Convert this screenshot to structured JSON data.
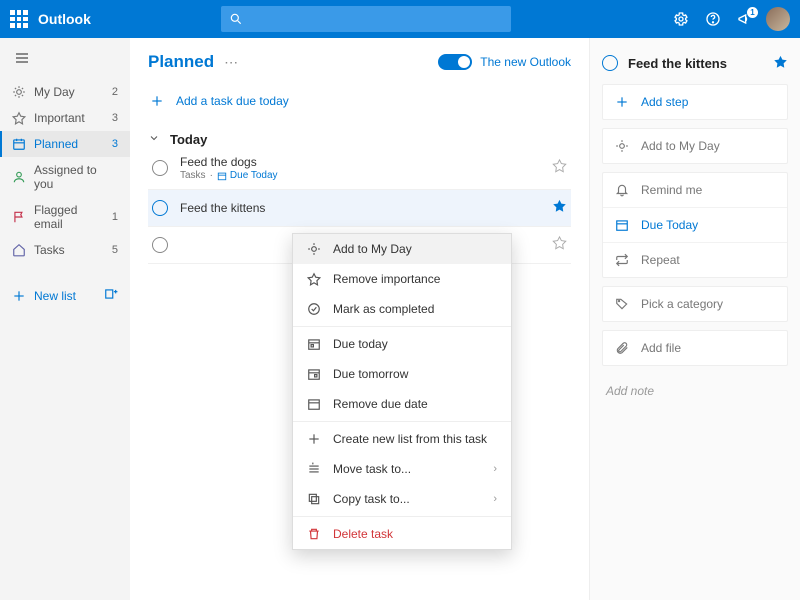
{
  "header": {
    "brand": "Outlook",
    "notification_count": "1"
  },
  "sidebar": {
    "items": [
      {
        "label": "My Day",
        "count": "2"
      },
      {
        "label": "Important",
        "count": "3"
      },
      {
        "label": "Planned",
        "count": "3"
      },
      {
        "label": "Assigned to you",
        "count": ""
      },
      {
        "label": "Flagged email",
        "count": "1"
      },
      {
        "label": "Tasks",
        "count": "5"
      }
    ],
    "new_list": "New list"
  },
  "main": {
    "title": "Planned",
    "toggle_label": "The new Outlook",
    "add_task": "Add a task due today",
    "section": "Today",
    "tasks": [
      {
        "title": "Feed the dogs",
        "sub_list": "Tasks",
        "due": "Due Today",
        "starred": false
      },
      {
        "title": "Feed the kittens",
        "starred": true
      },
      {
        "title": "",
        "starred": false
      }
    ]
  },
  "context_menu": {
    "add_myday": "Add to My Day",
    "remove_importance": "Remove importance",
    "mark_completed": "Mark as completed",
    "due_today": "Due today",
    "due_tomorrow": "Due tomorrow",
    "remove_due": "Remove due date",
    "create_list": "Create new list from this task",
    "move_to": "Move task to...",
    "copy_to": "Copy task to...",
    "delete": "Delete task"
  },
  "detail": {
    "title": "Feed the kittens",
    "add_step": "Add step",
    "add_myday": "Add to My Day",
    "remind": "Remind me",
    "due": "Due Today",
    "repeat": "Repeat",
    "category": "Pick a category",
    "add_file": "Add file",
    "note": "Add note"
  }
}
